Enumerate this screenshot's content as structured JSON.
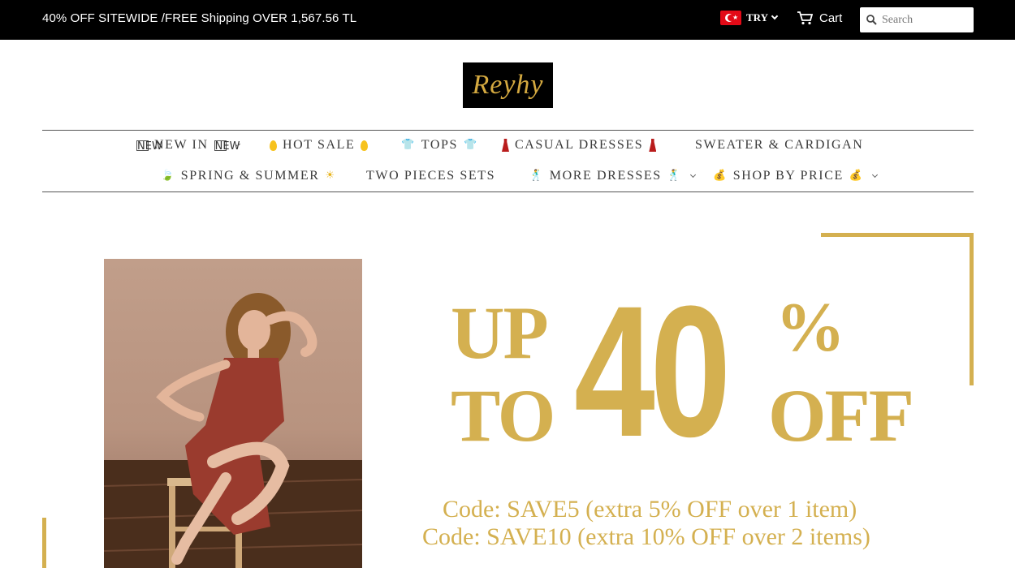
{
  "announcement": "40% OFF SITEWIDE /FREE Shipping OVER 1,567.56 TL",
  "currency": {
    "code": "TRY",
    "flag_icon": "turkey-flag-icon"
  },
  "cart": {
    "label": "Cart",
    "icon": "cart-icon"
  },
  "search": {
    "placeholder": "Search",
    "icon": "search-icon"
  },
  "logo": {
    "text": "Reyhy"
  },
  "nav": {
    "new_in": "NEW IN",
    "new_badge": "NEW",
    "hot_sale": "HOT SALE",
    "tops": "TOPS",
    "casual_dresses": "CASUAL DRESSES",
    "sweater_cardigan": "SWEATER & CARDIGAN",
    "spring_summer": "SPRING & SUMMER",
    "two_pieces": "TWO PIECES SETS",
    "more_dresses": "MORE DRESSES",
    "shop_by_price": "SHOP BY PRICE"
  },
  "banner": {
    "up": "UP",
    "to": "TO",
    "number": "40",
    "percent": "%",
    "off": "OFF",
    "code1": "Code: SAVE5 (extra 5% OFF over 1 item)",
    "code2": "Code: SAVE10 (extra 10% OFF over 2 items)"
  },
  "colors": {
    "accent_gold": "#d4b050",
    "topbar": "#000000"
  }
}
